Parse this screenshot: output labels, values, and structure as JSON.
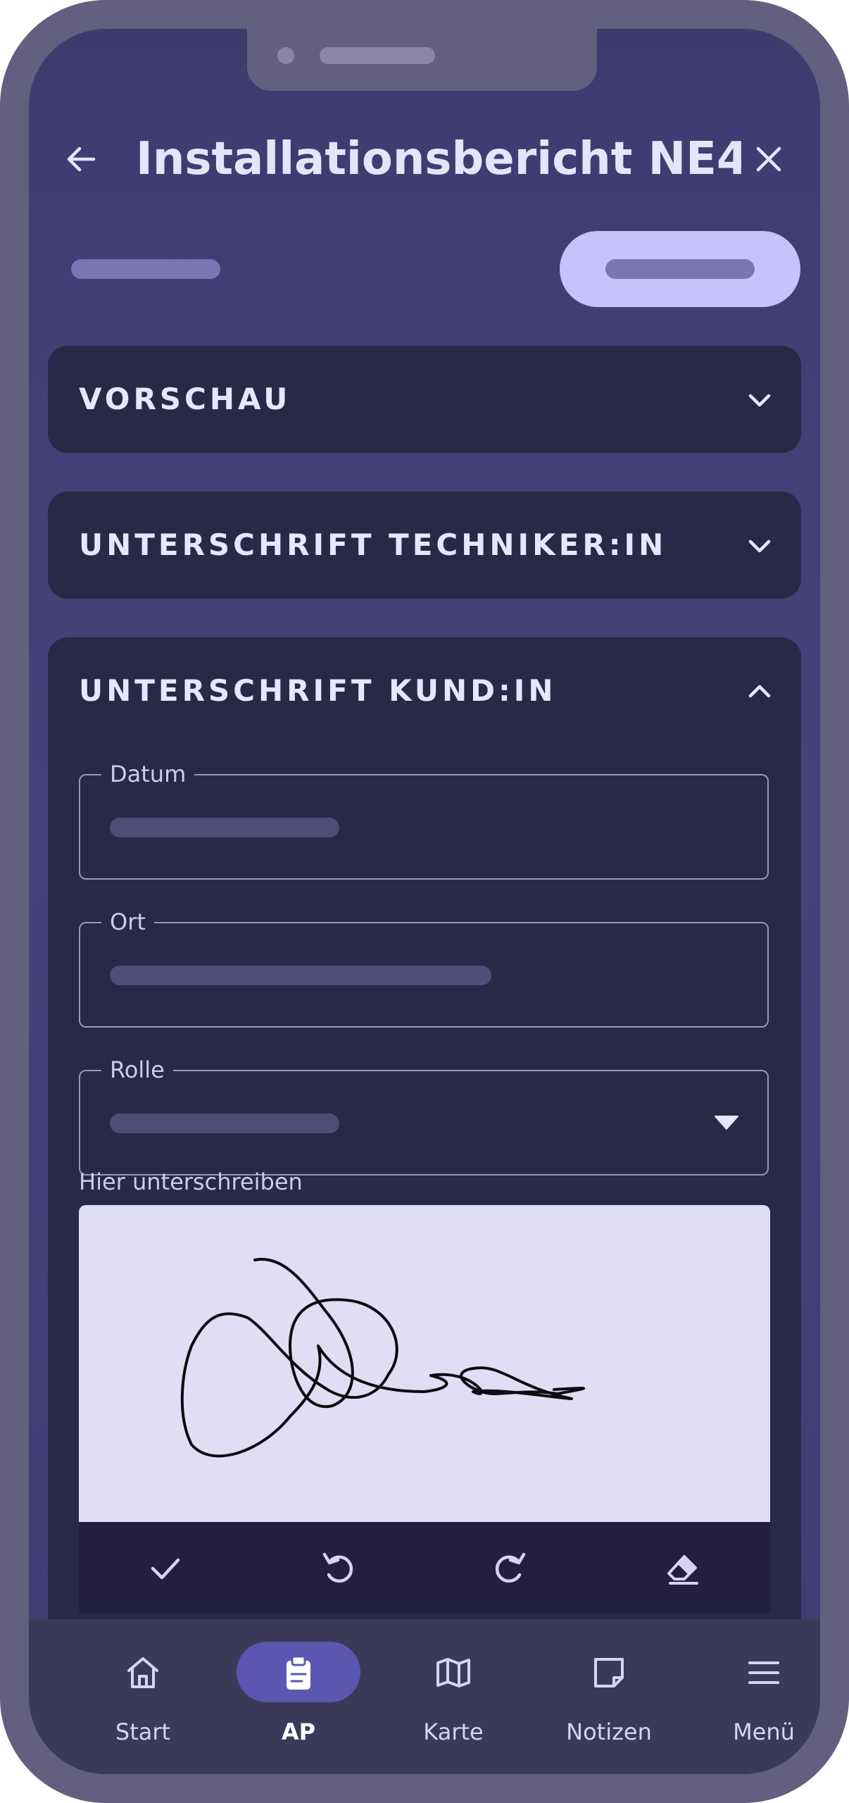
{
  "header": {
    "title": "Installationsbericht NE4 ...",
    "back_icon": "arrow-left-icon",
    "close_icon": "close-icon"
  },
  "sections": [
    {
      "title": "VORSCHAU",
      "expanded": false
    },
    {
      "title": "UNTERSCHRIFT TECHNIKER:IN",
      "expanded": false
    },
    {
      "title": "UNTERSCHRIFT KUND:IN",
      "expanded": true
    }
  ],
  "customer_signature": {
    "fields": {
      "date_label": "Datum",
      "place_label": "Ort",
      "role_label": "Rolle"
    },
    "signature_label": "Hier unterschreiben",
    "tools": [
      "check-icon",
      "undo-icon",
      "redo-icon",
      "eraser-icon"
    ]
  },
  "bottom_nav": {
    "items": [
      {
        "label": "Start",
        "icon": "home-icon",
        "active": false
      },
      {
        "label": "AP",
        "icon": "clipboard-icon",
        "active": true
      },
      {
        "label": "Karte",
        "icon": "map-icon",
        "active": false
      },
      {
        "label": "Notizen",
        "icon": "sticky-note-icon",
        "active": false
      },
      {
        "label": "Menü",
        "icon": "menu-icon",
        "active": false
      }
    ]
  },
  "colors": {
    "primary_container": "#c6c2fa",
    "card_background": "#2a2847",
    "nav_active": "#5b57b0"
  }
}
